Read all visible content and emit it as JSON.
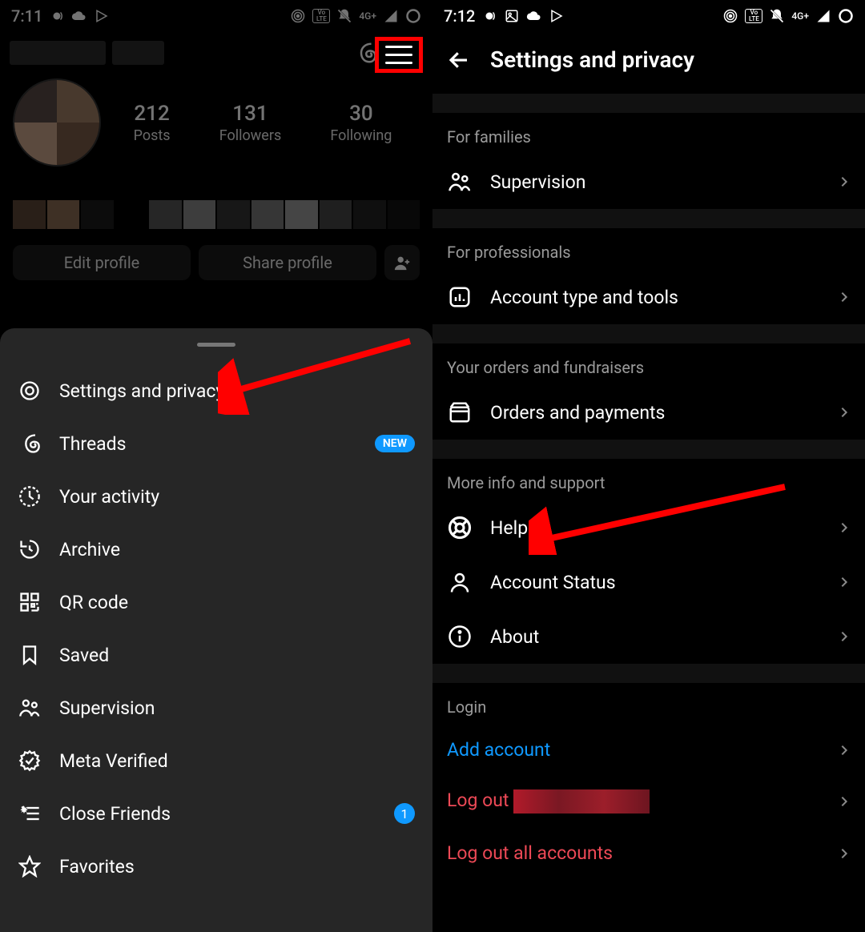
{
  "left": {
    "status": {
      "time": "7:11",
      "net": "4G+"
    },
    "profile": {
      "stats": {
        "posts": {
          "num": "212",
          "label": "Posts"
        },
        "followers": {
          "num": "131",
          "label": "Followers"
        },
        "following": {
          "num": "30",
          "label": "Following"
        }
      },
      "buttons": {
        "edit": "Edit profile",
        "share": "Share profile"
      }
    },
    "menu": {
      "settings": "Settings and privacy",
      "threads": "Threads",
      "threads_badge": "NEW",
      "activity": "Your activity",
      "archive": "Archive",
      "qr": "QR code",
      "saved": "Saved",
      "supervision": "Supervision",
      "meta": "Meta Verified",
      "close": "Close Friends",
      "close_badge": "1",
      "favorites": "Favorites"
    }
  },
  "right": {
    "status": {
      "time": "7:12",
      "net": "4G+"
    },
    "title": "Settings and privacy",
    "sections": {
      "families": {
        "label": "For families",
        "rows": {
          "supervision": "Supervision"
        }
      },
      "professionals": {
        "label": "For professionals",
        "rows": {
          "tools": "Account type and tools"
        }
      },
      "orders": {
        "label": "Your orders and fundraisers",
        "rows": {
          "orders": "Orders and payments"
        }
      },
      "support": {
        "label": "More info and support",
        "rows": {
          "help": "Help",
          "status": "Account Status",
          "about": "About"
        }
      },
      "login": {
        "label": "Login",
        "rows": {
          "add": "Add account",
          "logout": "Log out ",
          "logout_all": "Log out all accounts"
        }
      }
    }
  }
}
